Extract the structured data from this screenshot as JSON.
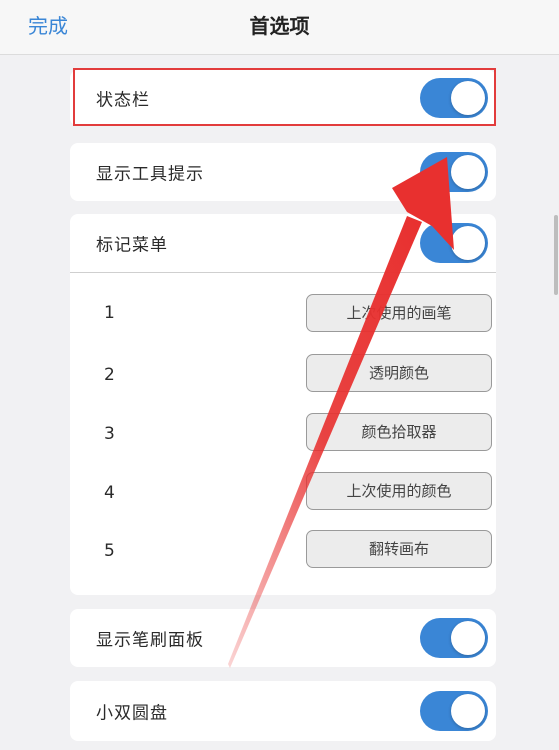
{
  "header": {
    "done_label": "完成",
    "title": "首选项"
  },
  "settings": {
    "status_bar": {
      "label": "状态栏",
      "on": true
    },
    "show_tooltips": {
      "label": "显示工具提示",
      "on": true
    },
    "mark_menu": {
      "label": "标记菜单",
      "on": true
    },
    "show_brush_panel": {
      "label": "显示笔刷面板",
      "on": true
    },
    "small_double_dial": {
      "label": "小双圆盘",
      "on": true
    }
  },
  "mark_menu_items": [
    {
      "number": "1",
      "action": "上次使用的画笔"
    },
    {
      "number": "2",
      "action": "透明颜色"
    },
    {
      "number": "3",
      "action": "颜色拾取器"
    },
    {
      "number": "4",
      "action": "上次使用的颜色"
    },
    {
      "number": "5",
      "action": "翻转画布"
    }
  ],
  "colors": {
    "accent": "#3a86d6",
    "highlight": "#e23c3c",
    "arrow": "#e8302f"
  }
}
